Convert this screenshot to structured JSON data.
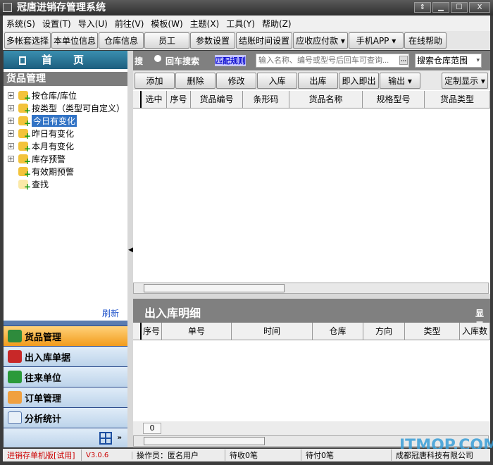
{
  "window": {
    "title": "冠唐进销存管理系统",
    "controls": [
      "⇕",
      "▁",
      "☐",
      "X"
    ]
  },
  "menu": [
    "系统(S)",
    "设置(T)",
    "导入(U)",
    "前往(V)",
    "模板(W)",
    "主题(X)",
    "工具(Y)",
    "帮助(Z)"
  ],
  "toolbar": [
    "多帐套选择",
    "本单位信息",
    "仓库信息",
    "员工",
    "参数设置",
    "结账时间设置",
    "应收应付款",
    "手机APP",
    "在线帮助"
  ],
  "left": {
    "home": "首　　页",
    "section_title": "货品管理",
    "tree": [
      "按仓库/库位",
      "按类型（类型可自定义）",
      "今日有变化",
      "昨日有变化",
      "本月有变化",
      "库存预警",
      "有效期预警",
      "查找"
    ],
    "selected": "今日有变化",
    "refresh": "刷新",
    "nav": [
      "货品管理",
      "出入库单据",
      "往来单位",
      "订单管理",
      "分析统计"
    ],
    "active_nav": "货品管理"
  },
  "search": {
    "label_left": "搜",
    "radio_label": "回车搜索",
    "match_rules": "匹配规则",
    "placeholder": "输入名称、编号或型号后回车可查询...",
    "scope": "搜索仓库范围"
  },
  "actions": [
    "添加",
    "删除",
    "修改",
    "入库",
    "出库",
    "即入即出",
    "输出"
  ],
  "custom_display": "定制显示",
  "grid": {
    "columns": [
      "选中",
      "序号",
      "货品编号",
      "条形码",
      "货品名称",
      "规格型号",
      "货品类型"
    ]
  },
  "detail": {
    "title": "出入库明细",
    "show": "显示",
    "columns": [
      "序号",
      "单号",
      "时间",
      "仓库",
      "方向",
      "类型",
      "入库数"
    ],
    "count": "0"
  },
  "status": {
    "edition": "进销存单机版[试用]",
    "version": "V3.0.6",
    "operator": "操作员：匿名用户",
    "receivable": "待收0笔",
    "payable": "待付0笔",
    "company": "成都冠唐科技有限公司"
  },
  "watermark": "ITMOP.COM"
}
